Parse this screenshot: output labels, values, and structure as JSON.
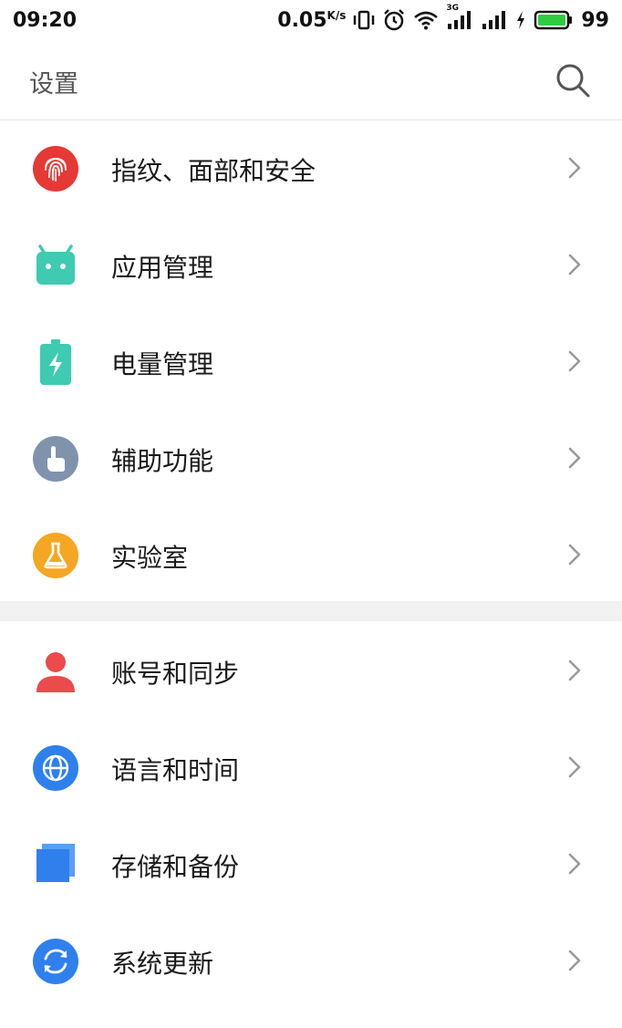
{
  "status_bar": {
    "time": "09:20",
    "network_speed": "0.05",
    "speed_unit": "K/s",
    "network_type": "3G",
    "battery_level": "99",
    "icons": [
      "vibrate-icon",
      "alarm-icon",
      "wifi-icon",
      "signal-3g-icon",
      "signal-icon",
      "charging-icon",
      "battery-icon"
    ]
  },
  "header": {
    "title": "设置",
    "search_icon": "search-icon"
  },
  "section1": {
    "items": [
      {
        "label": "指纹、面部和安全",
        "icon": "fingerprint-icon",
        "color": "#e53935"
      },
      {
        "label": "应用管理",
        "icon": "android-icon",
        "color": "#3ecbb1"
      },
      {
        "label": "电量管理",
        "icon": "battery-charge-icon",
        "color": "#3ecbb1"
      },
      {
        "label": "辅助功能",
        "icon": "accessibility-icon",
        "color": "#7f93ad"
      },
      {
        "label": "实验室",
        "icon": "lab-flask-icon",
        "color": "#f5a623"
      }
    ]
  },
  "section2": {
    "items": [
      {
        "label": "账号和同步",
        "icon": "account-icon",
        "color": "#ea4b4b"
      },
      {
        "label": "语言和时间",
        "icon": "globe-icon",
        "color": "#2f80ed"
      },
      {
        "label": "存储和备份",
        "icon": "storage-icon",
        "color": "#2f80ed"
      },
      {
        "label": "系统更新",
        "icon": "update-icon",
        "color": "#2f80ed"
      }
    ]
  }
}
